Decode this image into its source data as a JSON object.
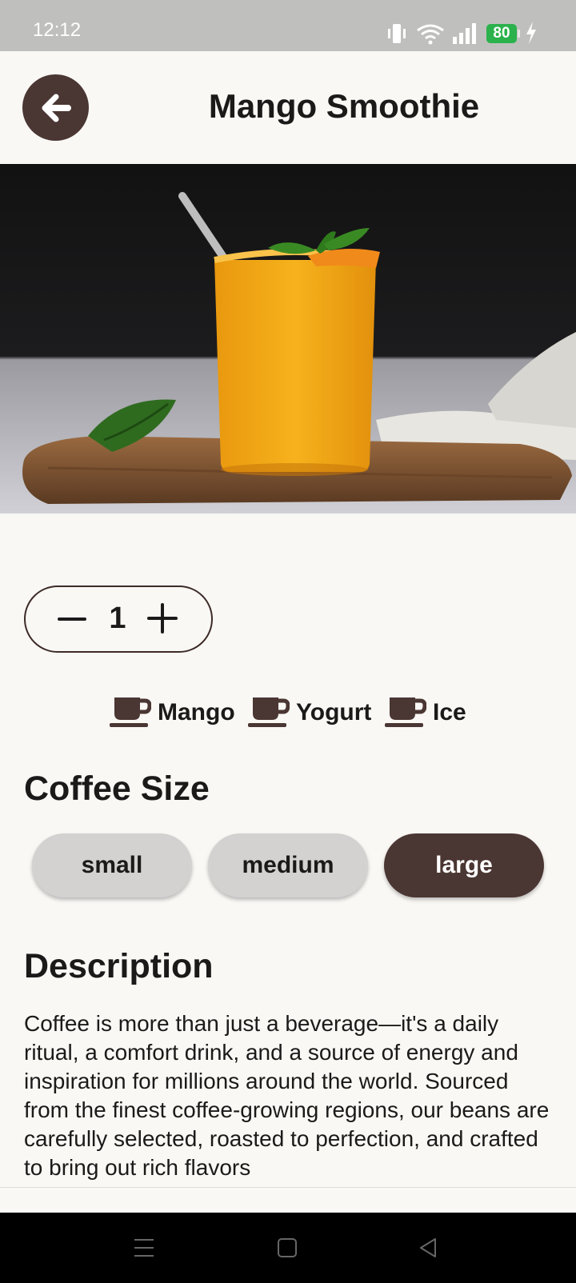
{
  "status_bar": {
    "time": "12:12",
    "battery_level": "80",
    "accent": "#2bb24c"
  },
  "app_bar": {
    "title": "Mango Smoothie",
    "back_icon": "arrow-left-icon"
  },
  "hero_image": {
    "subject": "mango smoothie in glass with mint on wooden board"
  },
  "quantity": {
    "value": "1",
    "minus_icon": "minus-icon",
    "plus_icon": "plus-icon"
  },
  "ingredients": [
    {
      "label": "Mango",
      "icon": "cup-icon"
    },
    {
      "label": "Yogurt",
      "icon": "cup-icon"
    },
    {
      "label": "Ice",
      "icon": "cup-icon"
    }
  ],
  "size_section": {
    "title": "Coffee Size",
    "options": [
      "small",
      "medium",
      "large"
    ],
    "selected": "large"
  },
  "description_section": {
    "title": "Description",
    "text": "Coffee is more than just a beverage—it's a daily ritual, a comfort drink, and a source of energy and inspiration for millions around the world. Sourced from the finest coffee-growing regions, our beans are carefully selected, roasted to perfection, and crafted to bring out rich flavors"
  },
  "colors": {
    "brand_dark": "#4a3632",
    "background": "#faf8f5",
    "chip": "#d4d2d0"
  }
}
